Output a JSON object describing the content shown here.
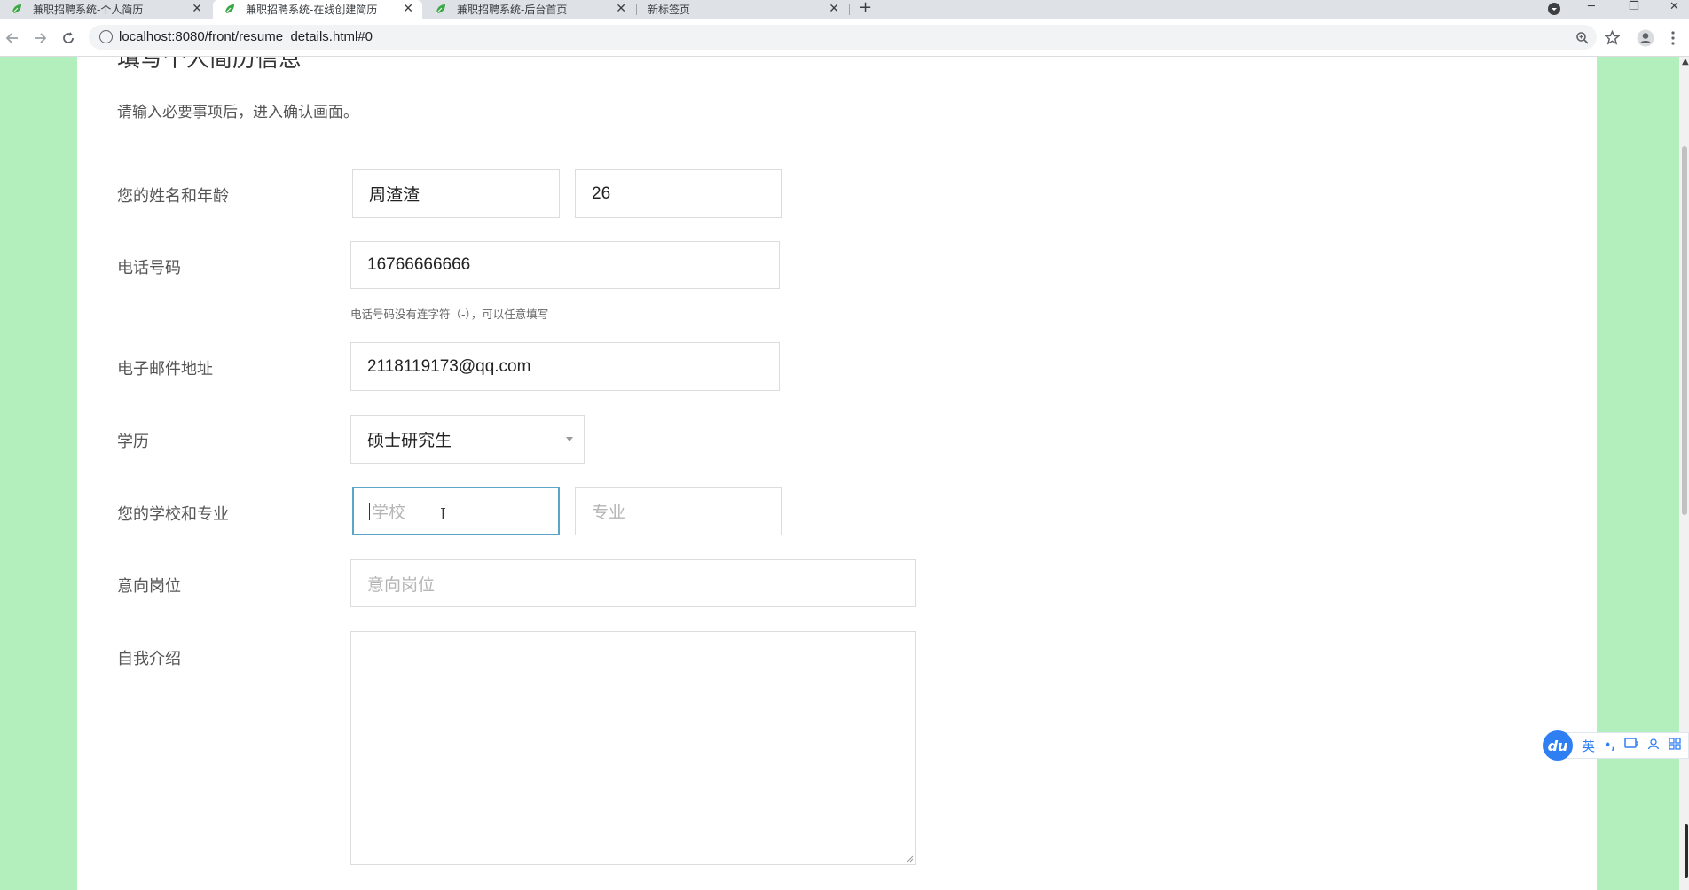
{
  "browser": {
    "tabs": [
      {
        "title": "兼职招聘系统-个人简历",
        "close": "✕"
      },
      {
        "title": "兼职招聘系统-在线创建简历",
        "close": "✕"
      },
      {
        "title": "兼职招聘系统-后台首页",
        "close": "✕"
      },
      {
        "title": "新标签页",
        "close": "✕"
      }
    ],
    "new_tab": "+",
    "url": "localhost:8080/front/resume_details.html#0",
    "window_controls": {
      "minimize": "─",
      "restore": "❐",
      "close": "✕"
    }
  },
  "page": {
    "partial_heading": "填写个人简历信息",
    "instruction": "请输入必要事项后，进入确认画面。",
    "name_age": {
      "label": "您的姓名和年龄",
      "name_value": "周渣渣",
      "age_value": "26"
    },
    "phone": {
      "label": "电话号码",
      "value": "16766666666",
      "hint": "电话号码没有连字符（-），可以任意填写"
    },
    "email": {
      "label": "电子邮件地址",
      "value": "2118119173@qq.com"
    },
    "education": {
      "label": "学历",
      "selected": "硕士研究生"
    },
    "school_major": {
      "label": "您的学校和专业",
      "school_placeholder": "学校",
      "major_placeholder": "专业"
    },
    "position": {
      "label": "意向岗位",
      "placeholder": "意向岗位"
    },
    "intro": {
      "label": "自我介绍",
      "value": ""
    }
  },
  "ime": {
    "logo": "du",
    "lang": "英",
    "punct": "•,"
  },
  "colors": {
    "page_background": "#b3eebd",
    "focus_border": "#5aa5c8",
    "ime_accent": "#2f7ff3"
  }
}
